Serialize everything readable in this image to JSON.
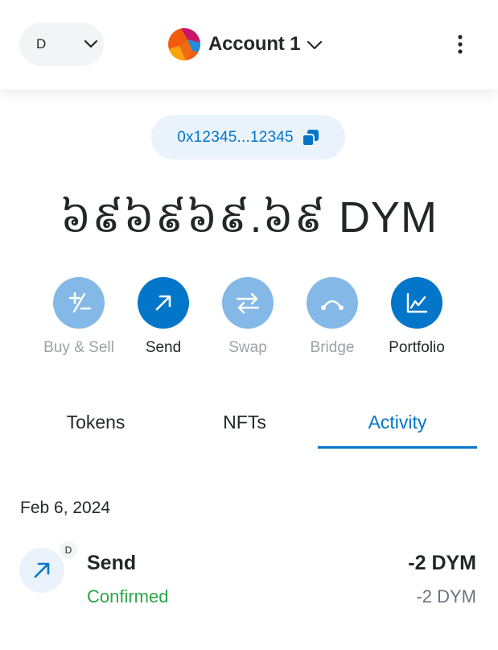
{
  "header": {
    "network_letter": "D",
    "account_name": "Account 1"
  },
  "address": {
    "short": "0x12345...12345"
  },
  "balance": {
    "amount": "៦៩៦៩៦៩.៦៩",
    "symbol": "DYM"
  },
  "actions": [
    {
      "label": "Buy & Sell",
      "enabled": false
    },
    {
      "label": "Send",
      "enabled": true
    },
    {
      "label": "Swap",
      "enabled": false
    },
    {
      "label": "Bridge",
      "enabled": false
    },
    {
      "label": "Portfolio",
      "enabled": true
    }
  ],
  "tabs": [
    {
      "label": "Tokens",
      "active": false
    },
    {
      "label": "NFTs",
      "active": false
    },
    {
      "label": "Activity",
      "active": true
    }
  ],
  "activity": {
    "date": "Feb 6, 2024",
    "items": [
      {
        "title": "Send",
        "status": "Confirmed",
        "amount": "-2 DYM",
        "fiat": "-2 DYM",
        "badge": "D",
        "icon": "arrow-up-right-icon"
      }
    ]
  },
  "colors": {
    "primary": "#0376c9",
    "primary_disabled": "#84b8e6",
    "success": "#28a745",
    "muted": "#9ca1a6",
    "text": "#24272a"
  }
}
